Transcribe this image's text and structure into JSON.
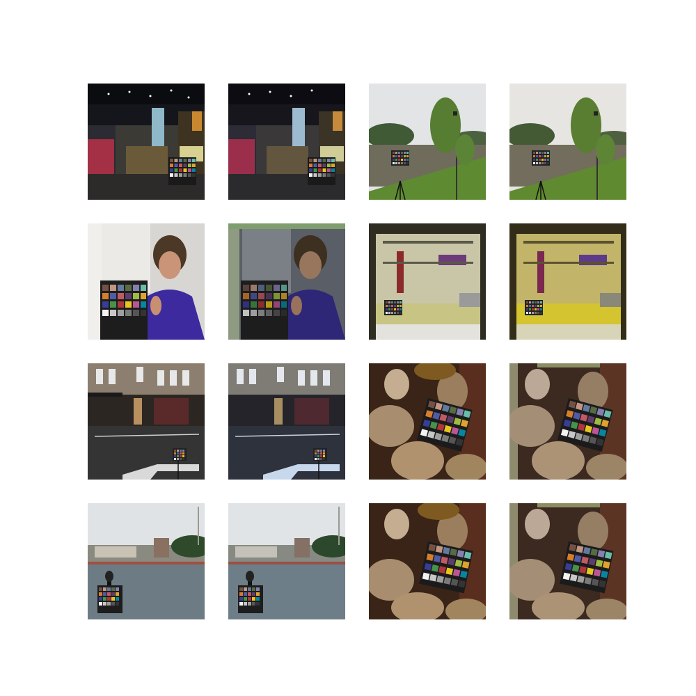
{
  "grid": {
    "rows": 4,
    "columns": 4,
    "cells": [
      {
        "row": 0,
        "col": 0,
        "scene": "night-market-stall-with-color-checker",
        "variant": "original"
      },
      {
        "row": 0,
        "col": 1,
        "scene": "night-market-stall-with-color-checker",
        "variant": "processed"
      },
      {
        "row": 0,
        "col": 2,
        "scene": "lake-tree-tripod-color-checker",
        "variant": "original"
      },
      {
        "row": 0,
        "col": 3,
        "scene": "lake-tree-tripod-color-checker",
        "variant": "processed"
      },
      {
        "row": 1,
        "col": 0,
        "scene": "person-holding-color-checker",
        "variant": "original"
      },
      {
        "row": 1,
        "col": 1,
        "scene": "person-holding-color-checker",
        "variant": "processed-with-artifacts"
      },
      {
        "row": 1,
        "col": 2,
        "scene": "workshop-tool-wall-color-checker",
        "variant": "original"
      },
      {
        "row": 1,
        "col": 3,
        "scene": "workshop-tool-wall-color-checker",
        "variant": "processed-yellow-cast"
      },
      {
        "row": 2,
        "col": 0,
        "scene": "street-buildings-color-checker",
        "variant": "original"
      },
      {
        "row": 2,
        "col": 1,
        "scene": "street-buildings-color-checker",
        "variant": "processed-blue-cast"
      },
      {
        "row": 2,
        "col": 2,
        "scene": "woven-rolls-color-checker",
        "variant": "original"
      },
      {
        "row": 2,
        "col": 3,
        "scene": "woven-rolls-color-checker",
        "variant": "processed-with-artifacts"
      },
      {
        "row": 3,
        "col": 0,
        "scene": "waterfront-color-checker",
        "variant": "original"
      },
      {
        "row": 3,
        "col": 1,
        "scene": "waterfront-color-checker",
        "variant": "processed"
      },
      {
        "row": 3,
        "col": 2,
        "scene": "woven-rolls-color-checker-2",
        "variant": "original"
      },
      {
        "row": 3,
        "col": 3,
        "scene": "woven-rolls-color-checker-2",
        "variant": "processed-with-artifacts"
      }
    ]
  },
  "checker_colors": [
    "#735244",
    "#c29682",
    "#627a9d",
    "#576c43",
    "#8580b1",
    "#67bdaa",
    "#d67e2c",
    "#505ba6",
    "#c15a63",
    "#5e3c6c",
    "#9dbc40",
    "#e0a32e",
    "#383d96",
    "#469449",
    "#af363c",
    "#e7c71f",
    "#bb5695",
    "#0885a1",
    "#f3f3f2",
    "#c8c8c8",
    "#a0a0a0",
    "#7a7a79",
    "#555555",
    "#343434"
  ]
}
